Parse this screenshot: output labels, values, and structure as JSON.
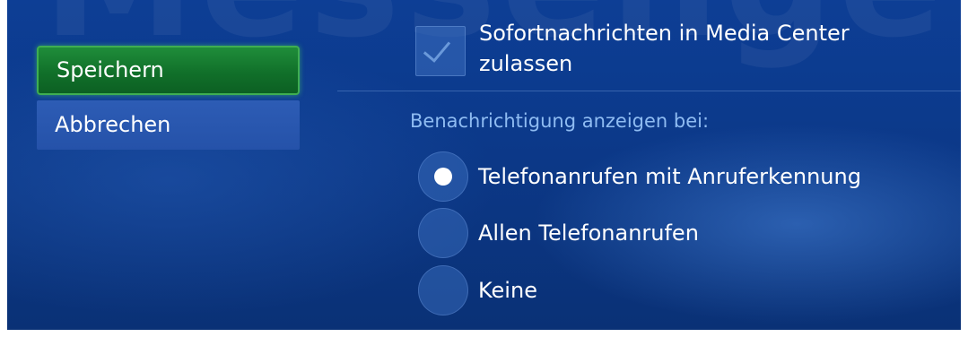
{
  "background_watermark": "Messenger",
  "nav": {
    "save_label": "Speichern",
    "cancel_label": "Abbrechen"
  },
  "options": {
    "allow_im_label": "Sofortnachrichten in Media Center zulassen",
    "allow_im_checked": true,
    "notify_heading": "Benachrichtigung anzeigen bei:",
    "radio_items": [
      {
        "label": "Telefonanrufen mit Anruferkennung",
        "selected": true
      },
      {
        "label": "Allen Telefonanrufen",
        "selected": false
      },
      {
        "label": "Keine",
        "selected": false
      }
    ]
  },
  "colors": {
    "background": "#0c3a8c",
    "selected_button": "#11702a",
    "button": "#2552a9",
    "heading_text": "#8fbcf2"
  }
}
